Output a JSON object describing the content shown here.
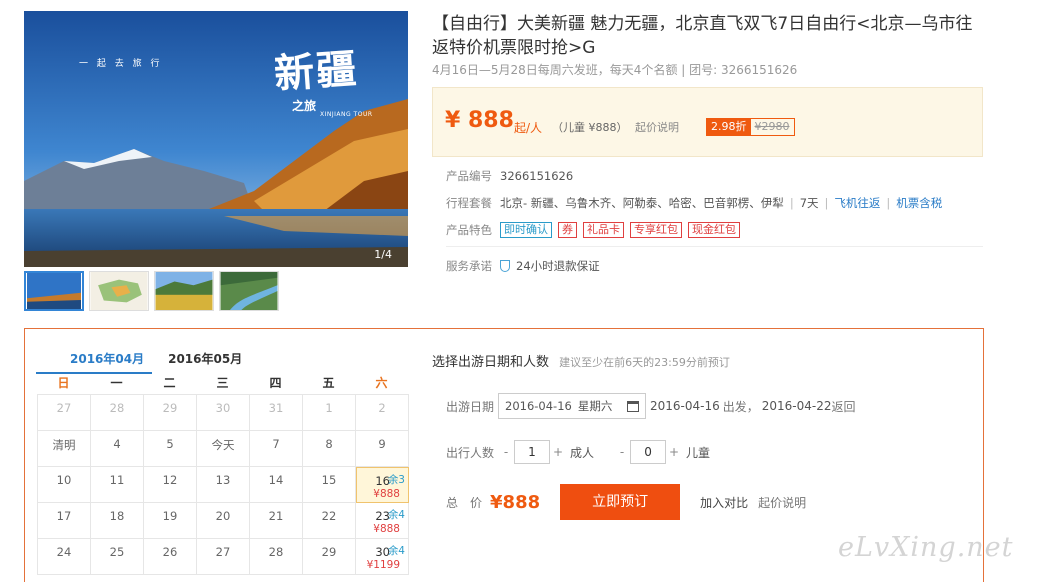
{
  "gallery": {
    "caption_small": "一 起 去 旅 行",
    "caption_big": "新疆",
    "caption_sub": "之旅",
    "caption_en": "XINJIANG TOUR",
    "counter": "1/4",
    "thumb_count": 4
  },
  "product": {
    "title": "【自由行】大美新疆 魅力无疆，北京直飞双飞7日自由行<北京—乌市往返特价机票限时抢>G",
    "subtitle": "4月16日—5月28日每周六发班，每天4个名额 | 团号: 3266151626",
    "price": {
      "amount": "¥ 888",
      "per": "起/人",
      "child": "（儿童 ¥888）",
      "explain_link": "起价说明",
      "discount": "2.98折",
      "original": "¥2980"
    },
    "code": {
      "label": "产品编号",
      "value": "3266151626"
    },
    "itinerary": {
      "label": "行程套餐",
      "route": "北京- 新疆、乌鲁木齐、阿勒泰、哈密、巴音郭楞、伊犁",
      "days": "7天",
      "transport": "飞机往返",
      "ticket": "机票含税"
    },
    "features": {
      "label": "产品特色",
      "tags": [
        "即时确认",
        "券",
        "礼品卡",
        "专享红包",
        "现金红包"
      ]
    },
    "service": {
      "label": "服务承诺",
      "value": "24小时退款保证"
    }
  },
  "calendar": {
    "tabs": [
      "2016年04月",
      "2016年05月"
    ],
    "weekdays": [
      "日",
      "一",
      "二",
      "三",
      "四",
      "五",
      "六"
    ],
    "rows": [
      [
        {
          "d": "27",
          "m": true
        },
        {
          "d": "28",
          "m": true
        },
        {
          "d": "29",
          "m": true
        },
        {
          "d": "30",
          "m": true
        },
        {
          "d": "31",
          "m": true
        },
        {
          "d": "1",
          "m": true
        },
        {
          "d": "2",
          "m": true
        }
      ],
      [
        {
          "d": "清明"
        },
        {
          "d": "4"
        },
        {
          "d": "5"
        },
        {
          "d": "今天"
        },
        {
          "d": "7"
        },
        {
          "d": "8"
        },
        {
          "d": "9"
        }
      ],
      [
        {
          "d": "10"
        },
        {
          "d": "11"
        },
        {
          "d": "12"
        },
        {
          "d": "13"
        },
        {
          "d": "14"
        },
        {
          "d": "15"
        },
        {
          "d": "16",
          "rem": "余3",
          "price": "¥888",
          "sel": true
        }
      ],
      [
        {
          "d": "17"
        },
        {
          "d": "18"
        },
        {
          "d": "19"
        },
        {
          "d": "20"
        },
        {
          "d": "21"
        },
        {
          "d": "22"
        },
        {
          "d": "23",
          "rem": "余4",
          "price": "¥888"
        }
      ],
      [
        {
          "d": "24"
        },
        {
          "d": "25"
        },
        {
          "d": "26"
        },
        {
          "d": "27"
        },
        {
          "d": "28"
        },
        {
          "d": "29"
        },
        {
          "d": "30",
          "rem": "余4",
          "price": "¥1199"
        }
      ]
    ]
  },
  "booking": {
    "title": "选择出游日期和人数",
    "hint": "建议至少在前6天的23:59分前预订",
    "date_label": "出游日期",
    "date_value": "2016-04-16",
    "date_weekday": "星期六",
    "depart_date": "2016-04-16",
    "depart_word": "出发，",
    "return_date": "2016-04-22",
    "return_word": "返回",
    "people_label": "出行人数",
    "adults": "1",
    "adult_word": "成人",
    "children": "0",
    "child_word": "儿童",
    "minus": "-",
    "plus": "+",
    "total_label": "总　价",
    "total": "¥888",
    "submit": "立即预订",
    "compare": "加入对比",
    "price_explain": "起价说明"
  },
  "watermark": "eLvXing.net",
  "colors": {
    "accent": "#ef4e10",
    "link": "#2a7cc7",
    "price_bg": "#fdf7e6"
  }
}
